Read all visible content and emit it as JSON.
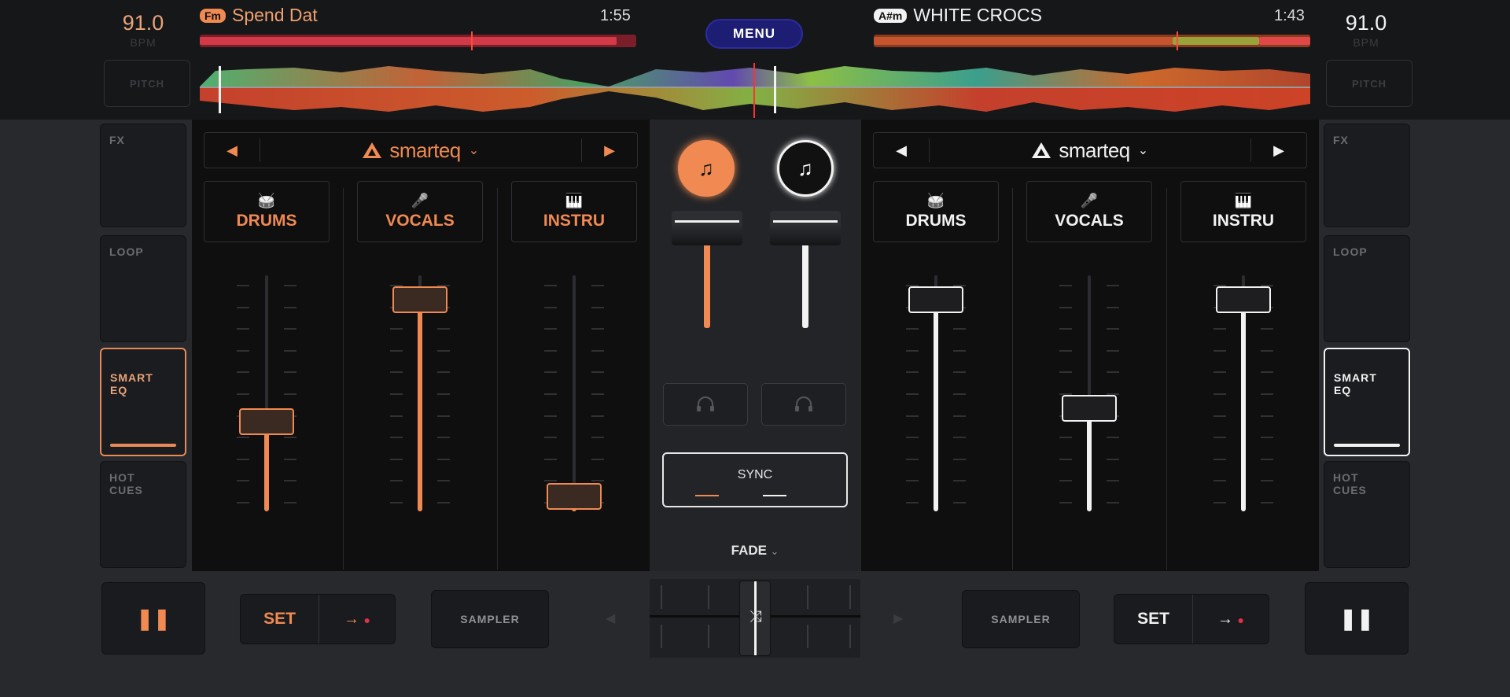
{
  "deck_left": {
    "bpm": "91.0",
    "bpm_unit": "BPM",
    "pitch_label": "PITCH",
    "key": "Fm",
    "title": "Spend Dat",
    "time": "1:55",
    "eq_name": "smarteq",
    "stems": [
      {
        "label": "DRUMS",
        "icon": "drum-icon",
        "level": 0.38
      },
      {
        "label": "VOCALS",
        "icon": "microphone-icon",
        "level": 1.0
      },
      {
        "label": "INSTRU",
        "icon": "piano-icon",
        "level": 0.0
      }
    ],
    "accent": "#f08a52",
    "side_buttons": [
      "FX",
      "LOOP",
      "SMART\nEQ",
      "HOT\nCUES"
    ],
    "active_side": "SMART\nEQ",
    "play_icon": "pause-icon",
    "set_label": "SET",
    "sampler_label": "SAMPLER"
  },
  "deck_right": {
    "bpm": "91.0",
    "bpm_unit": "BPM",
    "pitch_label": "PITCH",
    "key": "A#m",
    "title": "WHITE CROCS",
    "time": "1:43",
    "eq_name": "smarteq",
    "stems": [
      {
        "label": "DRUMS",
        "icon": "drum-icon",
        "level": 1.0
      },
      {
        "label": "VOCALS",
        "icon": "microphone-icon",
        "level": 0.45
      },
      {
        "label": "INSTRU",
        "icon": "piano-icon",
        "level": 1.0
      }
    ],
    "accent": "#f2f2f2",
    "side_buttons": [
      "FX",
      "LOOP",
      "SMART\nEQ",
      "HOT\nCUES"
    ],
    "active_side": "SMART\nEQ",
    "play_icon": "pause-icon",
    "set_label": "SET",
    "sampler_label": "SAMPLER"
  },
  "menu_label": "MENU",
  "mixer": {
    "sync_label": "SYNC",
    "fade_label": "FADE",
    "left_volume": 1.0,
    "right_volume": 1.0,
    "crossfader": 0.5
  }
}
